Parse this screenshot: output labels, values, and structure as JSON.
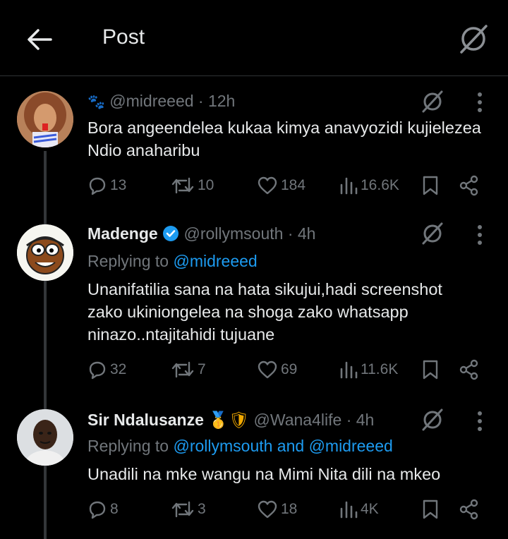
{
  "header": {
    "title": "Post"
  },
  "posts": [
    {
      "display_name": "",
      "emoji": "🐾",
      "handle": "@midreeed",
      "time": "· 12h",
      "replying_prefix": "",
      "replying_to": "",
      "text_lines": [
        "Bora angeendelea kukaa kimya anavyozidi kujielezea",
        "Ndio anaharibu"
      ],
      "replies": "13",
      "reposts": "10",
      "likes": "184",
      "views": "16.6K"
    },
    {
      "display_name": "Madenge",
      "handle": "@rollymsouth",
      "time": "· 4h",
      "replying_prefix": "Replying to ",
      "replying_to": "@midreeed",
      "text_lines": [
        "Unanifatilia sana na hata sikujui,hadi screenshot",
        "zako ukiniongelea na shoga zako whatsapp",
        "ninazo..ntajitahidi tujuane"
      ],
      "replies": "32",
      "reposts": "7",
      "likes": "69",
      "views": "11.6K"
    },
    {
      "display_name": "Sir Ndalusanze",
      "badges": "🥇🛡",
      "handle": "@Wana4life",
      "time": "· 4h",
      "replying_prefix": "Replying to ",
      "replying_to": "@rollymsouth and @midreeed",
      "text_lines": [
        "Unadili na mke wangu na Mimi Nita dili na mkeo"
      ],
      "replies": "8",
      "reposts": "3",
      "likes": "18",
      "views": "4K"
    }
  ],
  "colors": {
    "background": "#000000",
    "text": "#e7e9ea",
    "muted": "#71767b",
    "link": "#1d9bf0",
    "verified": "#1d9bf0"
  },
  "icons": [
    "back-arrow-icon",
    "grok-icon",
    "more-icon",
    "reply-icon",
    "repost-icon",
    "like-icon",
    "views-icon",
    "bookmark-icon",
    "share-icon",
    "verified-badge-icon"
  ]
}
